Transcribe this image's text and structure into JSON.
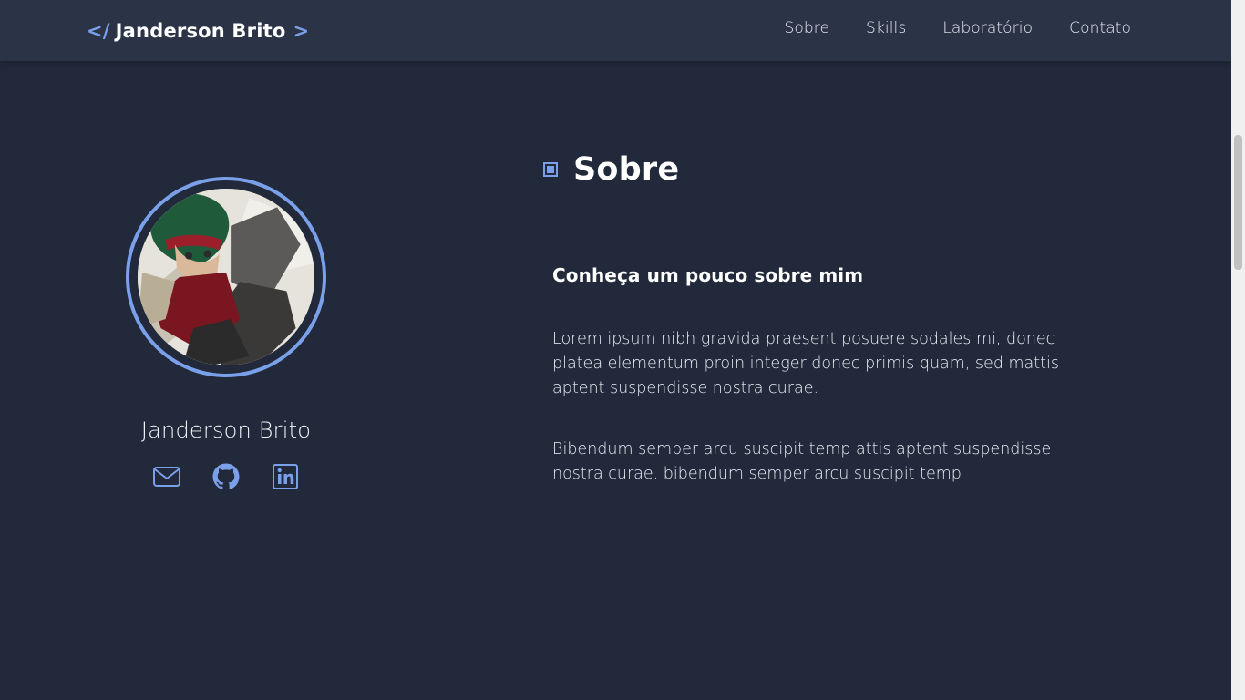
{
  "header": {
    "logo_open": "</",
    "logo_text": "Janderson Brito",
    "logo_close": ">",
    "nav": [
      {
        "label": "Sobre"
      },
      {
        "label": "Skills"
      },
      {
        "label": "Laboratório"
      },
      {
        "label": "Contato"
      }
    ]
  },
  "profile": {
    "name": "Janderson Brito",
    "socials": [
      {
        "icon": "mail-icon"
      },
      {
        "icon": "github-icon"
      },
      {
        "icon": "linkedin-icon"
      }
    ]
  },
  "about": {
    "title": "Sobre",
    "subtitle": "Conheça um pouco sobre mim",
    "paragraphs": [
      "Lorem ipsum nibh gravida praesent posuere sodales mi, donec platea elementum proin integer donec primis quam, sed mattis aptent suspendisse nostra curae.",
      "Bibendum semper arcu suscipit temp attis aptent suspendisse nostra curae. bibendum semper arcu suscipit temp"
    ]
  },
  "colors": {
    "background": "#21293a",
    "header": "#2b3447",
    "accent": "#7ba0ea"
  }
}
